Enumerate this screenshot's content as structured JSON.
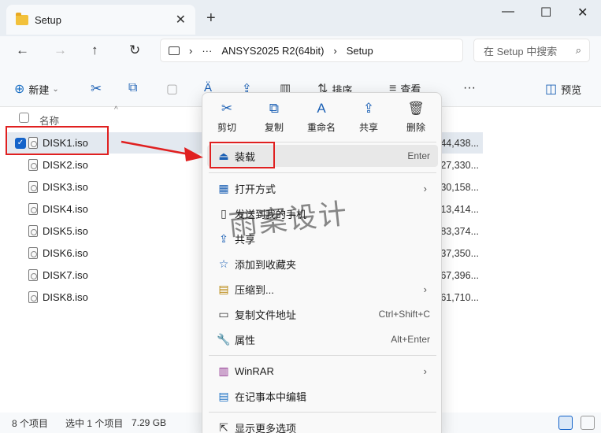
{
  "window": {
    "tab_title": "Setup",
    "tab_close": "✕",
    "new_tab": "+",
    "controls": {
      "minimize": "—",
      "maximize": "☐",
      "close": "✕"
    }
  },
  "nav": {
    "back": "←",
    "forward": "→",
    "up": "↑",
    "refresh": "↻"
  },
  "address": {
    "more": "···",
    "segments": [
      "ANSYS2025 R2(64bit)",
      "Setup"
    ],
    "separator": "›"
  },
  "search": {
    "placeholder": "在 Setup 中搜索",
    "icon": "search-icon"
  },
  "toolbar": {
    "new_label": "新建",
    "sort_label": "排序",
    "view_label": "查看",
    "more": "···",
    "preview_label": "预览"
  },
  "list": {
    "header_name": "名称",
    "files": [
      {
        "name": "DISK1.iso",
        "size": "44,438...",
        "selected": true
      },
      {
        "name": "DISK2.iso",
        "size": "27,330..."
      },
      {
        "name": "DISK3.iso",
        "size": "30,158..."
      },
      {
        "name": "DISK4.iso",
        "size": "13,414..."
      },
      {
        "name": "DISK5.iso",
        "size": "83,374..."
      },
      {
        "name": "DISK6.iso",
        "size": "37,350..."
      },
      {
        "name": "DISK7.iso",
        "size": "67,396..."
      },
      {
        "name": "DISK8.iso",
        "size": "61,710..."
      }
    ]
  },
  "status": {
    "count": "8 个项目",
    "selected": "选中 1 个项目",
    "size": "7.29 GB"
  },
  "context_menu": {
    "quick": [
      {
        "label": "剪切",
        "icon": "cut-icon",
        "glyph": "✂"
      },
      {
        "label": "复制",
        "icon": "copy-icon",
        "glyph": "⧉"
      },
      {
        "label": "重命名",
        "icon": "rename-icon",
        "glyph": "A"
      },
      {
        "label": "共享",
        "icon": "share-icon",
        "glyph": "⇪"
      },
      {
        "label": "删除",
        "icon": "delete-icon",
        "glyph": "🗑"
      }
    ],
    "items": [
      {
        "label": "装载",
        "key": "Enter",
        "icon": "mount-icon",
        "glyph": "⏏"
      },
      {
        "label": "打开方式",
        "arrow": "›",
        "icon": "open-with-icon",
        "glyph": "▦"
      },
      {
        "label": "发送到我的手机",
        "icon": "phone-icon",
        "glyph": "▯"
      },
      {
        "label": "共享",
        "icon": "share-icon",
        "glyph": "⇪"
      },
      {
        "label": "添加到收藏夹",
        "icon": "star-icon",
        "glyph": "☆"
      },
      {
        "label": "压缩到...",
        "arrow": "›",
        "icon": "zip-icon",
        "glyph": "▤"
      },
      {
        "label": "复制文件地址",
        "key": "Ctrl+Shift+C",
        "icon": "copy-path-icon",
        "glyph": "▭"
      },
      {
        "label": "属性",
        "key": "Alt+Enter",
        "icon": "wrench-icon",
        "glyph": "🔧"
      },
      {
        "label": "WinRAR",
        "arrow": "›",
        "icon": "winrar-icon",
        "glyph": "▥"
      },
      {
        "label": "在记事本中编辑",
        "icon": "notepad-icon",
        "glyph": "▤"
      },
      {
        "label": "显示更多选项",
        "icon": "more-options-icon",
        "glyph": "⇱"
      }
    ]
  },
  "watermark": "雨案设计",
  "colors": {
    "accent": "#1463c9",
    "annotation": "#e02020"
  }
}
